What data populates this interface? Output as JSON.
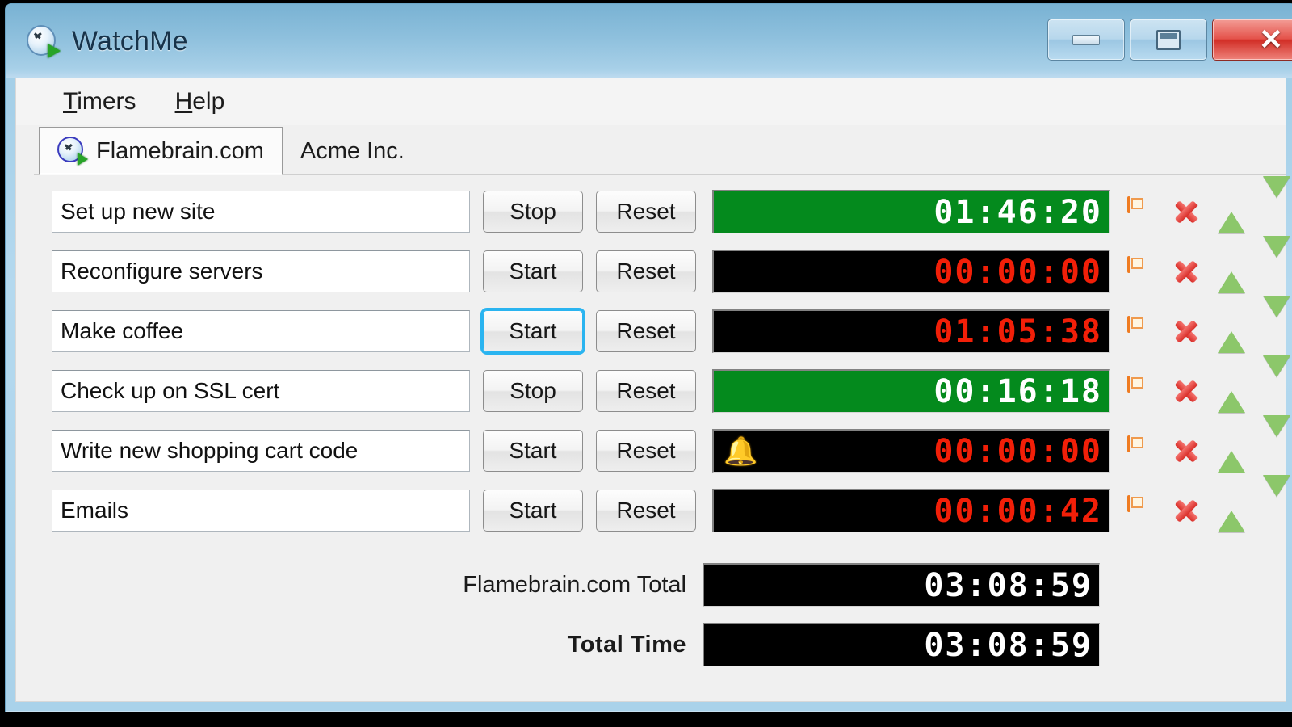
{
  "window": {
    "title": "WatchMe",
    "app_icon": "clock-play-icon",
    "controls": {
      "minimize": "minimize-icon",
      "maximize": "maximize-icon",
      "close": "close-icon",
      "close_glyph": "✕"
    }
  },
  "menu": {
    "items": [
      {
        "label": "Timers",
        "access_key": "T",
        "rest": "imers"
      },
      {
        "label": "Help",
        "access_key": "H",
        "rest": "elp"
      }
    ]
  },
  "tabs": [
    {
      "label": "Flamebrain.com",
      "active": true,
      "icon": "clock-play-icon"
    },
    {
      "label": "Acme Inc.",
      "active": false,
      "icon": ""
    }
  ],
  "buttons": {
    "start": "Start",
    "stop": "Stop",
    "reset": "Reset"
  },
  "colors": {
    "running_bg": "#048a1d",
    "running_text": "#ffffff",
    "stopped_bg": "#000000",
    "stopped_text": "#f21f08",
    "total_text": "#ffffff",
    "focus_ring": "#2ab4f0",
    "title_bar_top": "#79b2d3",
    "title_bar_bottom": "#bfdcf0",
    "delete_icon": "#d92f2a",
    "move_icon": "#8cc76a",
    "window_icon": "#ef7b21",
    "bell_icon": "#f2b705"
  },
  "timers": [
    {
      "name": "Set up new site",
      "toggle_label": "Stop",
      "reset_label": "Reset",
      "time": "01:46:20",
      "running": true,
      "focused": false,
      "alarm": false
    },
    {
      "name": "Reconfigure servers",
      "toggle_label": "Start",
      "reset_label": "Reset",
      "time": "00:00:00",
      "running": false,
      "focused": false,
      "alarm": false
    },
    {
      "name": "Make coffee",
      "toggle_label": "Start",
      "reset_label": "Reset",
      "time": "01:05:38",
      "running": false,
      "focused": true,
      "alarm": false
    },
    {
      "name": "Check up on SSL cert",
      "toggle_label": "Stop",
      "reset_label": "Reset",
      "time": "00:16:18",
      "running": true,
      "focused": false,
      "alarm": false
    },
    {
      "name": "Write new shopping cart code",
      "toggle_label": "Start",
      "reset_label": "Reset",
      "time": "00:00:00",
      "running": false,
      "focused": false,
      "alarm": true,
      "alarm_glyph": "🔔"
    },
    {
      "name": "Emails",
      "toggle_label": "Start",
      "reset_label": "Reset",
      "time": "00:00:42",
      "running": false,
      "focused": false,
      "alarm": false
    }
  ],
  "totals": [
    {
      "label": "Flamebrain.com Total",
      "time": "03:08:59",
      "bold": false
    },
    {
      "label": "Total Time",
      "time": "03:08:59",
      "bold": true
    }
  ],
  "row_action_icons": {
    "window": "window-icon",
    "delete": "delete-icon",
    "move_up": "move-up-icon",
    "move_down": "move-down-icon"
  }
}
